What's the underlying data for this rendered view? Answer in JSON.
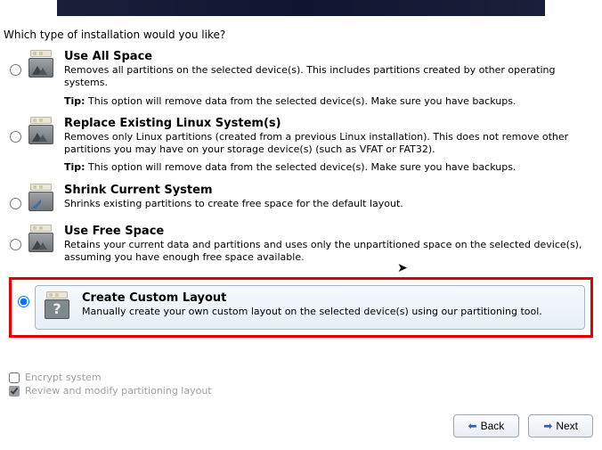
{
  "heading": "Which type of installation would you like?",
  "options": [
    {
      "title": "Use All Space",
      "desc": "Removes all partitions on the selected device(s).  This includes partitions created by other operating systems.",
      "tip_label": "Tip:",
      "tip": "This option will remove data from the selected device(s).  Make sure you have backups."
    },
    {
      "title": "Replace Existing Linux System(s)",
      "desc": "Removes only Linux partitions (created from a previous Linux installation).  This does not remove other partitions you may have on your storage device(s) (such as VFAT or FAT32).",
      "tip_label": "Tip:",
      "tip": "This option will remove data from the selected device(s).  Make sure you have backups."
    },
    {
      "title": "Shrink Current System",
      "desc": "Shrinks existing partitions to create free space for the default layout.",
      "tip_label": "",
      "tip": ""
    },
    {
      "title": "Use Free Space",
      "desc": "Retains your current data and partitions and uses only the unpartitioned space on the selected device(s), assuming you have enough free space available.",
      "tip_label": "",
      "tip": ""
    },
    {
      "title": "Create Custom Layout",
      "desc": "Manually create your own custom layout on the selected device(s) using our partitioning tool.",
      "tip_label": "",
      "tip": ""
    }
  ],
  "selected_index": 4,
  "checks": {
    "encrypt": "Encrypt system",
    "review": "Review and modify partitioning layout"
  },
  "buttons": {
    "back": "Back",
    "next": "Next"
  }
}
